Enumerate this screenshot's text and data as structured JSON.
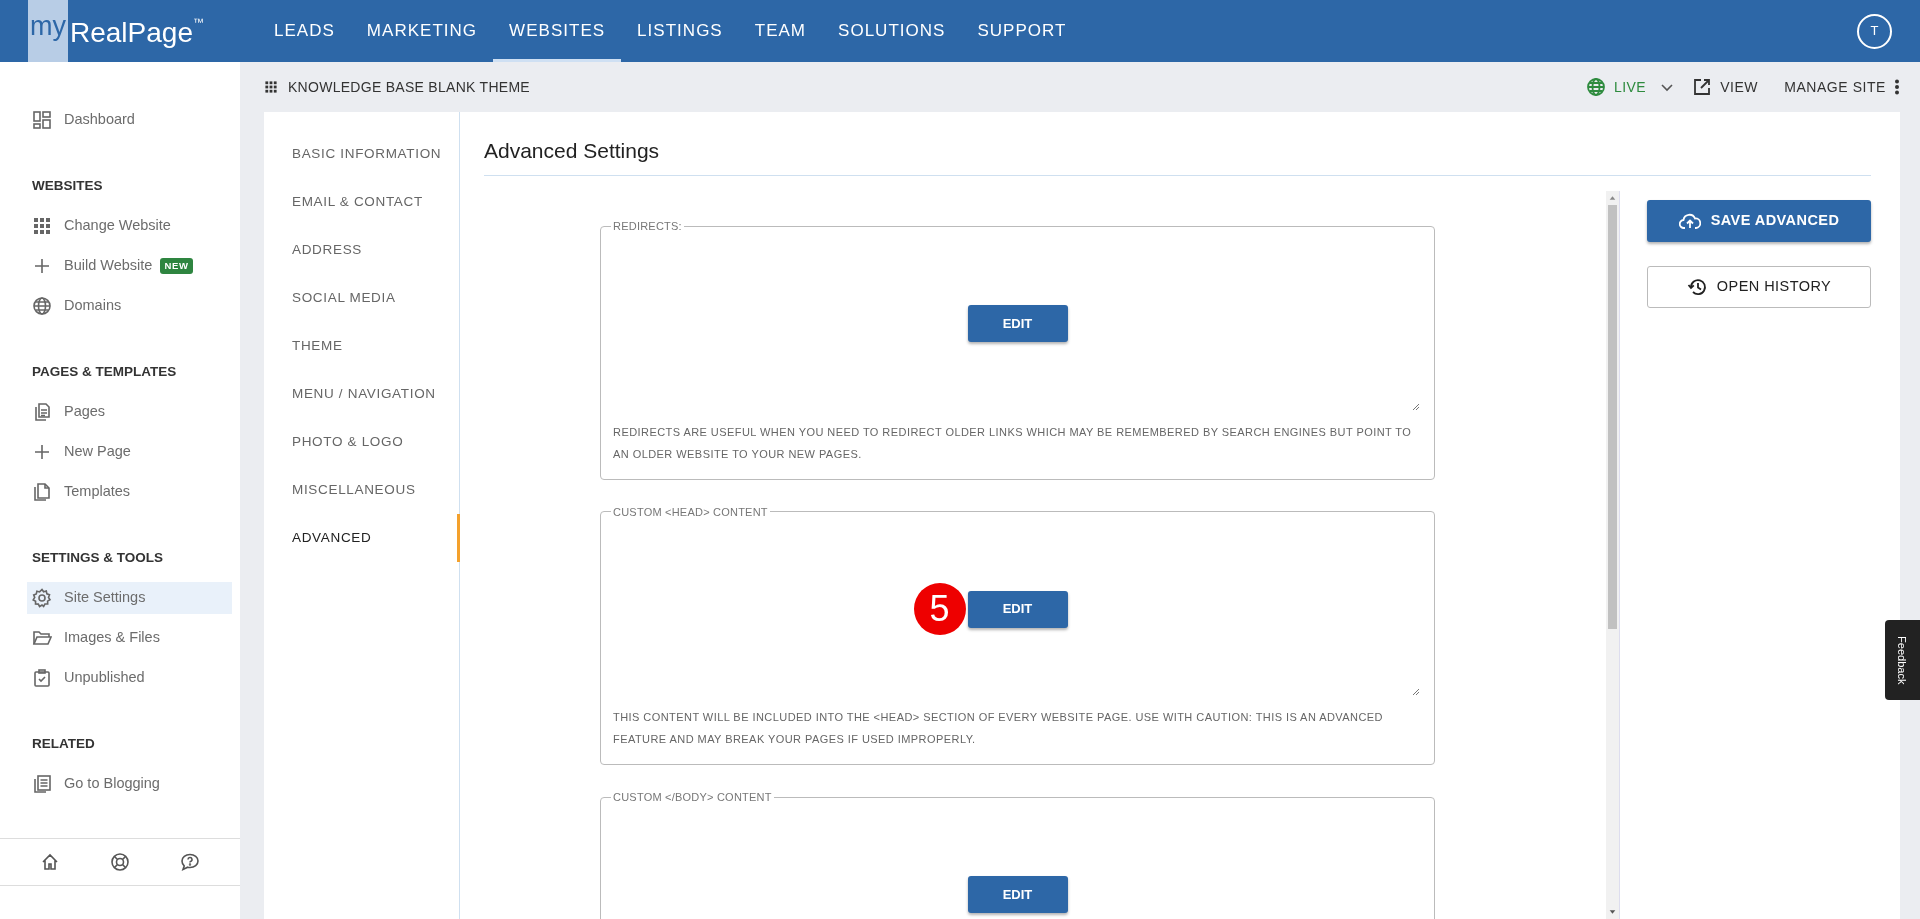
{
  "navbar": {
    "logo_prefix": "my",
    "logo_name": "RealPage",
    "logo_mark": "™",
    "avatar": "T",
    "items": [
      {
        "label": "LEADS",
        "selected": false
      },
      {
        "label": "MARKETING",
        "selected": false
      },
      {
        "label": "WEBSITES",
        "selected": true
      },
      {
        "label": "LISTINGS",
        "selected": false
      },
      {
        "label": "TEAM",
        "selected": false
      },
      {
        "label": "SOLUTIONS",
        "selected": false
      },
      {
        "label": "SUPPORT",
        "selected": false
      }
    ]
  },
  "sidebar": {
    "sections": [
      {
        "items": [
          {
            "label": "Dashboard",
            "selected": false
          }
        ]
      },
      {
        "heading": "WEBSITES",
        "items": [
          {
            "label": "Change Website",
            "selected": false
          },
          {
            "label": "Build Website",
            "badge": "NEW",
            "selected": false
          },
          {
            "label": "Domains",
            "selected": false
          }
        ]
      },
      {
        "heading": "PAGES & TEMPLATES",
        "items": [
          {
            "label": "Pages",
            "selected": false
          },
          {
            "label": "New Page",
            "selected": false
          },
          {
            "label": "Templates",
            "selected": false
          }
        ]
      },
      {
        "heading": "SETTINGS & TOOLS",
        "items": [
          {
            "label": "Site Settings",
            "selected": true
          },
          {
            "label": "Images & Files",
            "selected": false
          },
          {
            "label": "Unpublished",
            "selected": false
          }
        ]
      },
      {
        "heading": "RELATED",
        "items": [
          {
            "label": "Go to Blogging",
            "selected": false
          }
        ]
      }
    ]
  },
  "subheader": {
    "title": "KNOWLEDGE BASE BLANK THEME",
    "status": "LIVE",
    "view": "VIEW",
    "manage": "MANAGE SITE"
  },
  "settings_nav": [
    {
      "label": "BASIC INFORMATION",
      "selected": false
    },
    {
      "label": "EMAIL & CONTACT",
      "selected": false
    },
    {
      "label": "ADDRESS",
      "selected": false
    },
    {
      "label": "SOCIAL MEDIA",
      "selected": false
    },
    {
      "label": "THEME",
      "selected": false
    },
    {
      "label": "MENU / NAVIGATION",
      "selected": false
    },
    {
      "label": "PHOTO & LOGO",
      "selected": false
    },
    {
      "label": "MISCELLANEOUS",
      "selected": false
    },
    {
      "label": "ADVANCED",
      "selected": true
    }
  ],
  "page": {
    "title": "Advanced Settings",
    "sections": [
      {
        "legend": "REDIRECTS:",
        "button": "EDIT",
        "help": "REDIRECTS ARE USEFUL WHEN YOU NEED TO REDIRECT OLDER LINKS WHICH MAY BE REMEMBERED BY SEARCH ENGINES BUT POINT TO AN OLDER WEBSITE TO YOUR NEW PAGES."
      },
      {
        "legend": "CUSTOM <HEAD> CONTENT",
        "button": "EDIT",
        "step_marker": "5",
        "help": "THIS CONTENT WILL BE INCLUDED INTO THE <HEAD> SECTION OF EVERY WEBSITE PAGE. USE WITH CAUTION: THIS IS AN ADVANCED FEATURE AND MAY BREAK YOUR PAGES IF USED IMPROPERLY."
      },
      {
        "legend": "CUSTOM </BODY> CONTENT",
        "button": "EDIT"
      }
    ]
  },
  "actions": {
    "save": "SAVE ADVANCED",
    "history": "OPEN HISTORY"
  },
  "feedback": "Feedback"
}
